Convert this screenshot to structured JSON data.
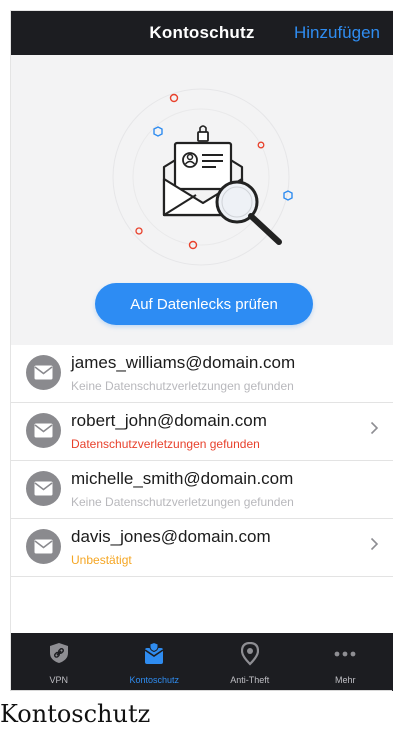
{
  "header": {
    "title": "Kontoschutz",
    "action_label": "Hinzufügen"
  },
  "hero": {
    "check_button_label": "Auf Datenlecks prüfen"
  },
  "accounts": [
    {
      "email": "james_williams@domain.com",
      "status": "Keine Datenschutzverletzungen gefunden",
      "status_color": "#b8b8bc",
      "has_chevron": false
    },
    {
      "email": "robert_john@domain.com",
      "status": "Datenschutzverletzungen gefunden",
      "status_color": "#e8412c",
      "has_chevron": true
    },
    {
      "email": "michelle_smith@domain.com",
      "status": "Keine Datenschutzverletzungen gefunden",
      "status_color": "#b8b8bc",
      "has_chevron": false
    },
    {
      "email": "davis_jones@domain.com",
      "status": "Unbestätigt",
      "status_color": "#f5a623",
      "has_chevron": true
    }
  ],
  "tabbar": {
    "tabs": [
      {
        "label": "VPN",
        "icon": "shield-link-icon",
        "active": false
      },
      {
        "label": "Kontoschutz",
        "icon": "account-protection-icon",
        "active": true
      },
      {
        "label": "Anti-Theft",
        "icon": "location-pin-icon",
        "active": false
      },
      {
        "label": "Mehr",
        "icon": "more-dots-icon",
        "active": false
      }
    ]
  },
  "caption": "Kontoschutz",
  "colors": {
    "accent": "#2f8cf0",
    "bar": "#1c1d21",
    "alert": "#e8412c",
    "warning": "#f5a623"
  }
}
